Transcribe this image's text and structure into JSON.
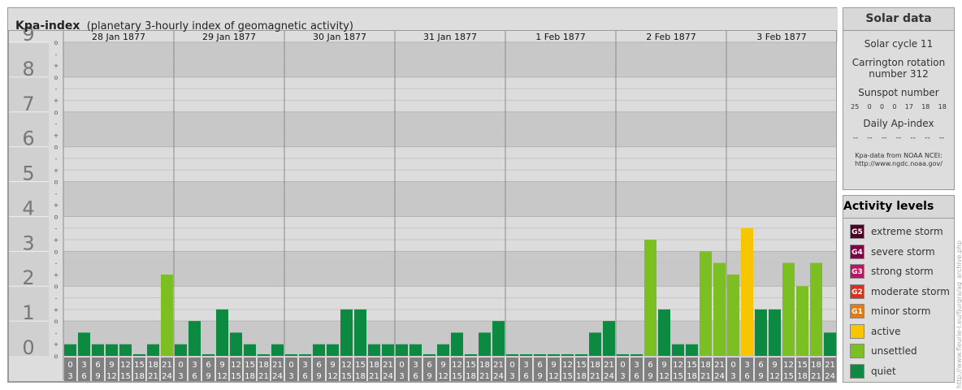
{
  "header": {
    "title": "Kpa-index",
    "subtitle": "(planetary 3-hourly index of geomagnetic activity)"
  },
  "chart_data": {
    "type": "bar",
    "title": "Kpa-index",
    "subtitle": "(planetary 3-hourly index of geomagnetic activity)",
    "ylim": [
      0,
      9
    ],
    "y_ticks": [
      "0",
      "1",
      "2",
      "3",
      "4",
      "5",
      "6",
      "7",
      "8",
      "9"
    ],
    "sub_ticks": [
      "o",
      "-",
      "+"
    ],
    "days": [
      "28 Jan 1877",
      "29 Jan 1877",
      "30 Jan 1877",
      "31 Jan 1877",
      "1 Feb 1877",
      "2 Feb 1877",
      "3 Feb 1877"
    ],
    "interval_start_labels": [
      "0",
      "3",
      "6",
      "9",
      "12",
      "15",
      "18",
      "21"
    ],
    "interval_end_labels": [
      "3",
      "6",
      "9",
      "12",
      "15",
      "18",
      "21",
      "24"
    ],
    "values": [
      0.333,
      0.667,
      0.333,
      0.333,
      0.333,
      0.0,
      0.333,
      2.333,
      0.333,
      1.0,
      0.0,
      1.333,
      0.667,
      0.333,
      0.0,
      0.333,
      0.0,
      0.0,
      0.333,
      0.333,
      1.333,
      1.333,
      0.333,
      0.333,
      0.333,
      0.333,
      0.0,
      0.333,
      0.667,
      0.0,
      0.667,
      1.0,
      0.0,
      0.0,
      0.0,
      0.0,
      0.0,
      0.0,
      0.667,
      1.0,
      0.0,
      0.0,
      3.333,
      1.333,
      0.333,
      0.333,
      3.0,
      2.667,
      2.333,
      3.667,
      1.333,
      1.333,
      2.667,
      2.0,
      2.667,
      0.667
    ],
    "colors": {
      "quiet": "#0c8a42",
      "unsettled": "#7bbf22",
      "active": "#f7c600"
    },
    "band_colors": [
      "#c8c8c8",
      "#dcdcdc"
    ]
  },
  "solar_data": {
    "title": "Solar data",
    "solar_cycle": "Solar cycle 11",
    "carrington_line1": "Carrington rotation",
    "carrington_line2": "number 312",
    "sunspot_title": "Sunspot number",
    "sunspots": [
      "25",
      "0",
      "0",
      "0",
      "17",
      "18",
      "18"
    ],
    "ap_title": "Daily Ap-index",
    "ap_values": [
      "--",
      "--",
      "--",
      "--",
      "--",
      "--",
      "--"
    ],
    "source_line1": "Kpa-data from NOAA NCEI:",
    "source_line2": "http://www.ngdc.noaa.gov/"
  },
  "activity_levels": {
    "title": "Activity levels",
    "items": [
      {
        "code": "G5",
        "label": "extreme storm",
        "color": "#4d0022"
      },
      {
        "code": "G4",
        "label": "severe storm",
        "color": "#800045"
      },
      {
        "code": "G3",
        "label": "strong storm",
        "color": "#b8175f"
      },
      {
        "code": "G2",
        "label": "moderate storm",
        "color": "#d4331f"
      },
      {
        "code": "G1",
        "label": "minor storm",
        "color": "#e07b15"
      },
      {
        "code": "",
        "label": "active",
        "color": "#f7c600"
      },
      {
        "code": "",
        "label": "unsettled",
        "color": "#7bbf22"
      },
      {
        "code": "",
        "label": "quiet",
        "color": "#0c8a42"
      }
    ]
  },
  "watermark": "http://www.fleurie-l.eu/fjurgra/ag_archive.php"
}
